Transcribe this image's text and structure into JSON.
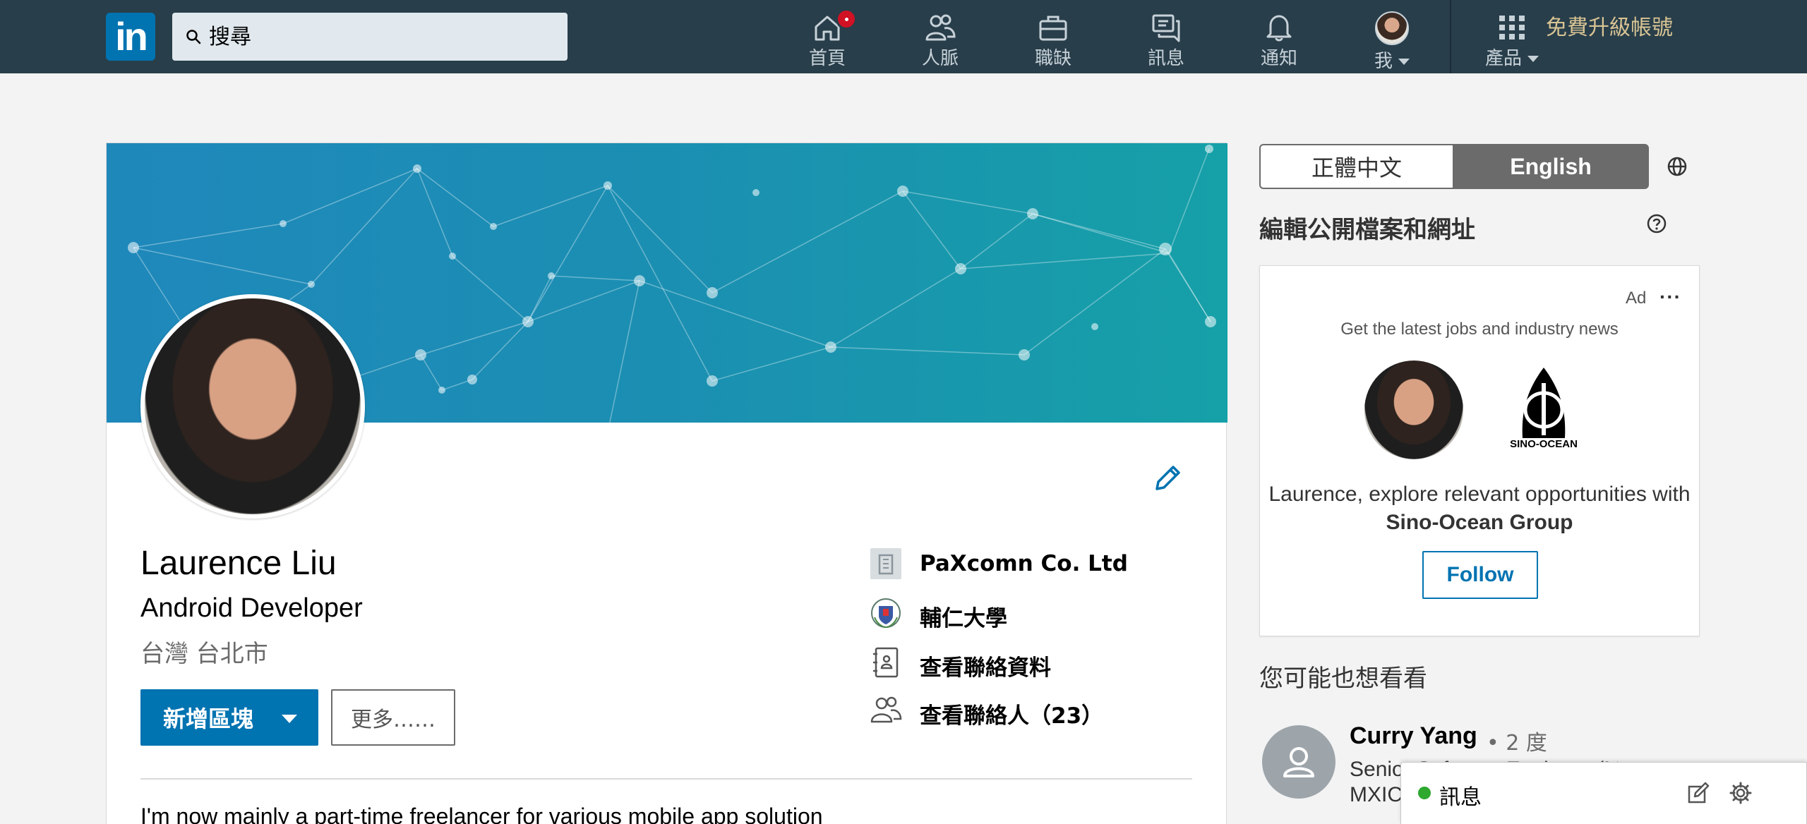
{
  "nav": {
    "logo_text": "in",
    "search_placeholder": "搜尋",
    "items": [
      {
        "label": "首頁",
        "icon": "home-icon",
        "has_badge": true
      },
      {
        "label": "人脈",
        "icon": "people-icon"
      },
      {
        "label": "職缺",
        "icon": "briefcase-icon"
      },
      {
        "label": "訊息",
        "icon": "messaging-icon"
      },
      {
        "label": "通知",
        "icon": "bell-icon"
      },
      {
        "label": "我",
        "icon": "avatar",
        "has_caret": true
      },
      {
        "label": "產品",
        "icon": "grid-icon",
        "has_caret": true
      }
    ],
    "premium": "免費升級帳號"
  },
  "profile": {
    "name": "Laurence Liu",
    "headline": "Android Developer",
    "location": "台灣 台北市",
    "add_section_label": "新增區塊",
    "more_label": "更多……",
    "about_preview": "I'm now mainly a part-time freelancer for various mobile app solution",
    "info": [
      {
        "text": "PaXcomn Co. Ltd",
        "icon": "company-icon"
      },
      {
        "text": "輔仁大學",
        "icon": "school-logo-icon"
      },
      {
        "text": "查看聯絡資料",
        "icon": "contact-card-icon"
      },
      {
        "text": "查看聯絡人（23）",
        "icon": "connections-icon"
      }
    ]
  },
  "sidebar": {
    "lang_zh": "正體中文",
    "lang_en": "English",
    "edit_public": "編輯公開檔案和網址",
    "ad": {
      "label": "Ad",
      "dots": "···",
      "subtitle": "Get the latest jobs and industry news",
      "logo_text": "SINO-OCEAN",
      "message_prefix": "Laurence, explore relevant opportunities with ",
      "company": "Sino-Ocean Group",
      "follow_label": "Follow"
    },
    "pymk_title": "您可能也想看看",
    "pymk": {
      "name": "Curry Yang",
      "degree": "• 2 度",
      "line1": "Senior Software Engineer (MES)",
      "line2": "MXIC"
    }
  },
  "messaging": {
    "label": "訊息"
  },
  "colors": {
    "nav_bg": "#283e4a",
    "brand_blue": "#0073b1",
    "premium_gold": "#d9c494",
    "online_green": "#2ea82e"
  }
}
